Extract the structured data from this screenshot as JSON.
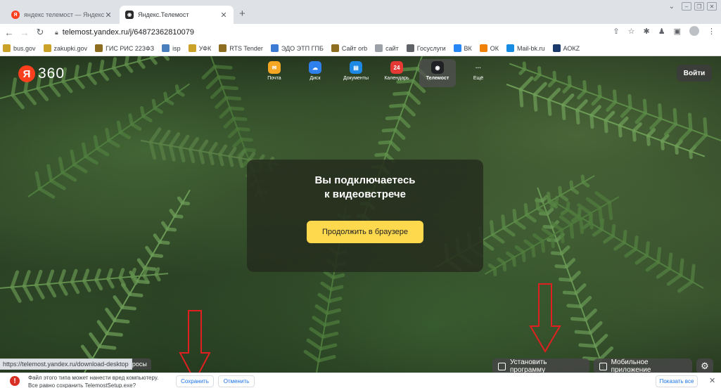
{
  "browser": {
    "tabs": [
      {
        "title": "яндекс телемост — Яндекс: нашлось...",
        "icon": "yandex-icon",
        "active": false
      },
      {
        "title": "Яндекс.Телемост",
        "icon": "telemost-icon",
        "active": true
      }
    ],
    "new_tab": "+",
    "url": "telemost.yandex.ru/j/64872362810079",
    "bookmarks": [
      {
        "label": "bus.gov",
        "color": "#c9a227"
      },
      {
        "label": "zakupki.gov",
        "color": "#c9a227"
      },
      {
        "label": "ГИС РИС 223ФЗ",
        "color": "#8d6e20"
      },
      {
        "label": "isp",
        "color": "#4a7fbd"
      },
      {
        "label": "УФК",
        "color": "#c9a227"
      },
      {
        "label": "RTS Tender",
        "color": "#8d6e20"
      },
      {
        "label": "ЭДО ЭТП ГПБ",
        "color": "#3b7bd4"
      },
      {
        "label": "Сайт orb",
        "color": "#8d6e20"
      },
      {
        "label": "сайт",
        "color": "#9aa0a6"
      },
      {
        "label": "Госуслуги",
        "color": "#5f6368"
      },
      {
        "label": "ВК",
        "color": "#2787f5"
      },
      {
        "label": "ОК",
        "color": "#ee8208"
      },
      {
        "label": "Mail-bk.ru",
        "color": "#168de2"
      },
      {
        "label": "АОКZ",
        "color": "#1a3a6b"
      }
    ]
  },
  "header": {
    "logo_ya": "Я",
    "logo_text": "360",
    "services": [
      {
        "label": "Почта",
        "color": "#f5a623",
        "glyph": "✉",
        "active": false
      },
      {
        "label": "Диск",
        "color": "#2f80ed",
        "glyph": "☁",
        "active": false
      },
      {
        "label": "Документы",
        "color": "#1e88e5",
        "glyph": "▤",
        "active": false
      },
      {
        "label": "Календарь",
        "color": "#e53935",
        "glyph": "24",
        "active": false
      },
      {
        "label": "Телемост",
        "color": "#202124",
        "glyph": "◉",
        "active": true
      },
      {
        "label": "Ещё",
        "color": "transparent",
        "glyph": "···",
        "active": false
      }
    ],
    "login_label": "Войти"
  },
  "card": {
    "title_line1": "Вы подключаетесь",
    "title_line2": "к видеовстрече",
    "continue_label": "Продолжить в браузере"
  },
  "bottom": {
    "status_url": "https://telemost.yandex.ru/download-desktop",
    "polls_label": "опросы",
    "install_label": "Установить программу",
    "mobile_label": "Мобильное приложение"
  },
  "download_bar": {
    "warning_line1": "Файл этого типа может нанести вред компьютеру.",
    "warning_line2": "Все равно сохранить TelemostSetup.exe?",
    "save_label": "Сохранить",
    "cancel_label": "Отменить",
    "show_all_label": "Показать все",
    "close_label": "✕"
  },
  "colors": {
    "accent_yellow": "#ffd94d",
    "yandex_red": "#fc3f1d",
    "annotation_red": "#e02020"
  }
}
